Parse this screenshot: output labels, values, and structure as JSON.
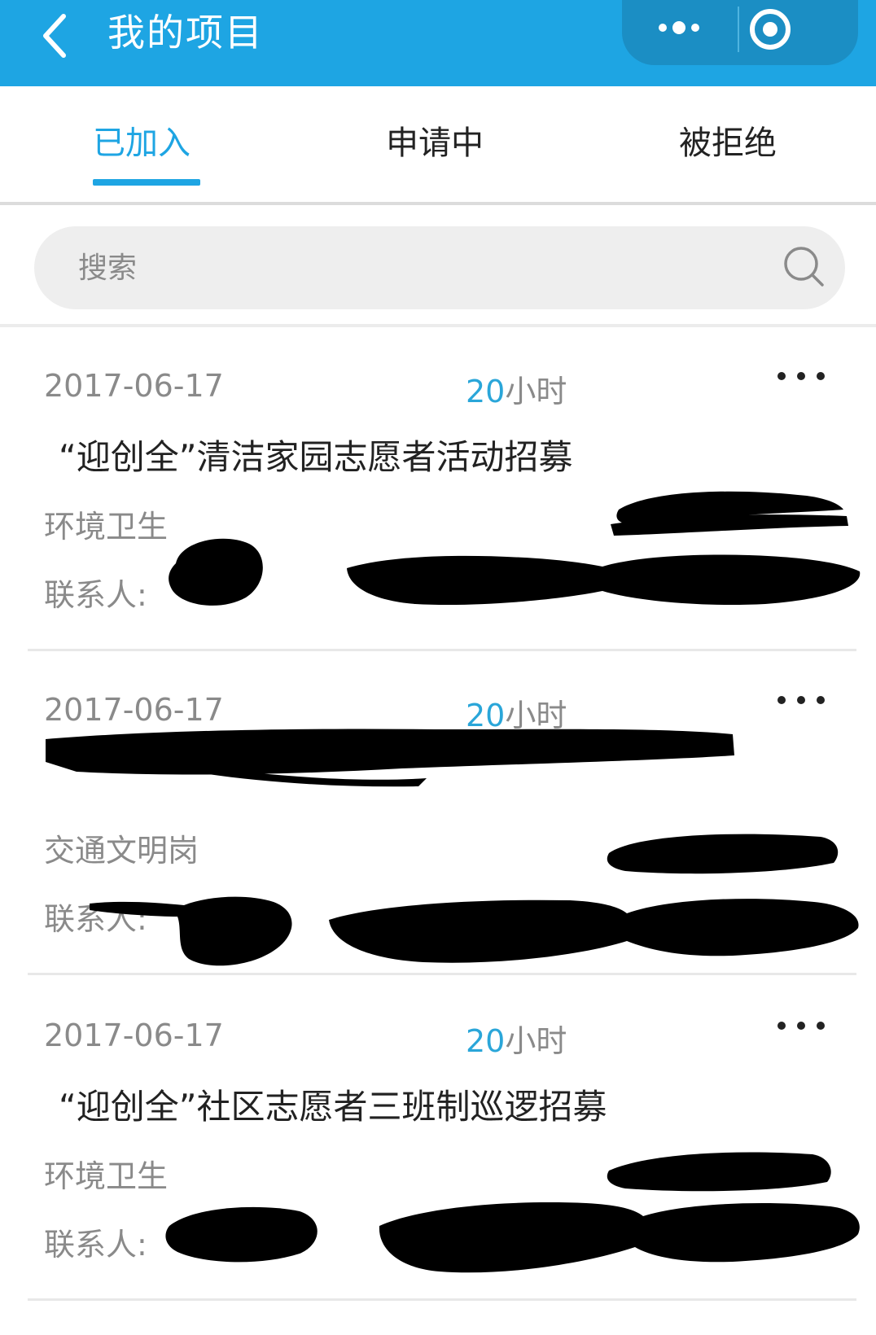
{
  "header": {
    "title": "我的项目",
    "back_icon": "chevron-left-icon",
    "more_icon": "more-dots-icon",
    "close_icon": "target-circle-icon",
    "bar_color": "#1ea5e3"
  },
  "tabs": [
    {
      "label": "已加入",
      "active": true
    },
    {
      "label": "申请中",
      "active": false
    },
    {
      "label": "被拒绝",
      "active": false
    }
  ],
  "search": {
    "placeholder": "搜索",
    "icon": "search-icon"
  },
  "projects": [
    {
      "date": "2017-06-17",
      "hours_value": "20",
      "hours_unit": "小时",
      "title": "“迎创全”清洁家园志愿者活动招募",
      "category": "环境卫生",
      "contact_label": "联系人:",
      "redacted": true
    },
    {
      "date": "2017-06-17",
      "hours_value": "20",
      "hours_unit": "小时",
      "title": "",
      "category": "交通文明岗",
      "contact_label": "联系人:",
      "redacted": true
    },
    {
      "date": "2017-06-17",
      "hours_value": "20",
      "hours_unit": "小时",
      "title": "“迎创全”社区志愿者三班制巡逻招募",
      "category": "环境卫生",
      "contact_label": "联系人:",
      "redacted": true
    }
  ]
}
